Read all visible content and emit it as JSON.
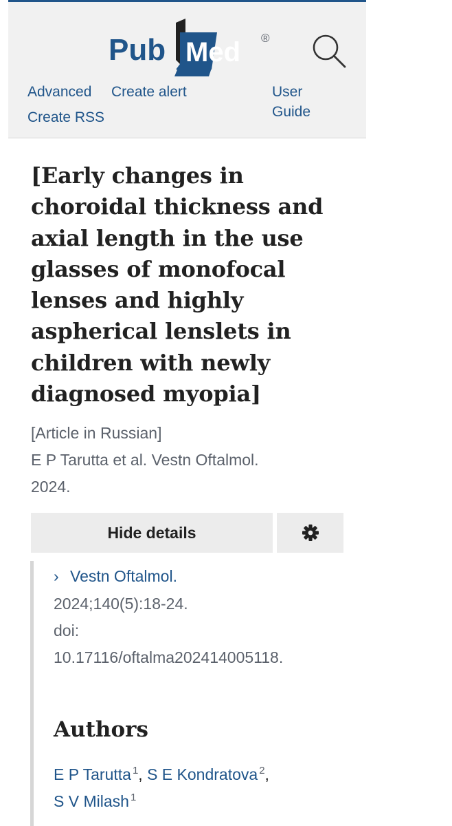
{
  "header": {
    "logo": {
      "pub": "Pub",
      "med": "Med",
      "reg": "®"
    },
    "links": {
      "advanced": "Advanced",
      "create_alert": "Create alert",
      "create_rss": "Create RSS",
      "user_guide_1": "User",
      "user_guide_2": "Guide"
    }
  },
  "article": {
    "title_lines": [
      "[Early changes in",
      "choroidal thickness and",
      "axial length in the use",
      "glasses of monofocal",
      "lenses and highly",
      "aspherical lenslets in",
      "children with newly",
      "diagnosed myopia]"
    ],
    "language_note": "[Article in Russian]",
    "citation_short_1": "E P Tarutta et al. Vestn Oftalmol.",
    "citation_short_2": "2024."
  },
  "buttons": {
    "hide_details": "Hide details"
  },
  "details": {
    "journal": "Vestn Oftalmol.",
    "volume_pages": "2024;140(5):18-24.",
    "doi_label": "doi:",
    "doi": "10.17116/oftalma202414005118."
  },
  "authors": {
    "heading": "Authors",
    "list": [
      {
        "name": "E P Tarutta",
        "aff": "1"
      },
      {
        "name": "S E Kondratova",
        "aff": "2"
      },
      {
        "name": "S V Milash",
        "aff": "1"
      }
    ]
  },
  "colors": {
    "brand_blue": "#20558a",
    "header_bg": "#f1f1f1",
    "button_bg": "#ececec"
  }
}
